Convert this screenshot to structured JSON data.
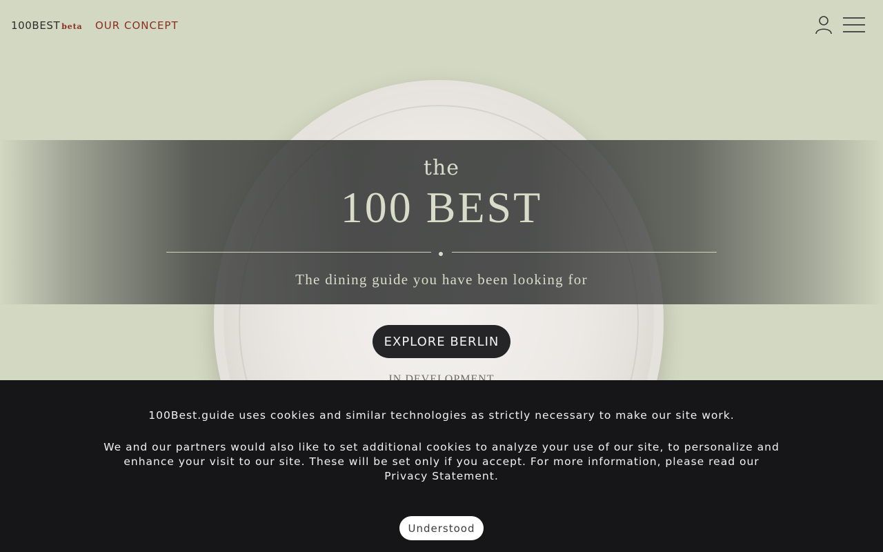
{
  "header": {
    "brand": "100BEST",
    "brand_badge": "beta",
    "concept_link": "OUR CONCEPT",
    "user_icon": "user-icon",
    "menu_icon": "hamburger-menu-icon"
  },
  "hero": {
    "the": "the",
    "title": "100 BEST",
    "tagline": "The dining guide you have been looking for",
    "cta": "EXPLORE BERLIN",
    "status": "IN DEVELOPMENT"
  },
  "cookie": {
    "line1": "100Best.guide uses cookies and similar technologies as strictly necessary to make our site work.",
    "line2": "We and our partners would also like to set additional cookies to analyze your use of our site, to personalize and enhance your visit to our site. These will be set only if you accept. For more information, please read our Privacy Statement.",
    "accept": "Understood"
  },
  "colors": {
    "background": "#d3d8c2",
    "accent": "#8a2e1f",
    "banner": "#161618",
    "cta_bg": "#252528",
    "hero_text": "#d9dcc9"
  }
}
